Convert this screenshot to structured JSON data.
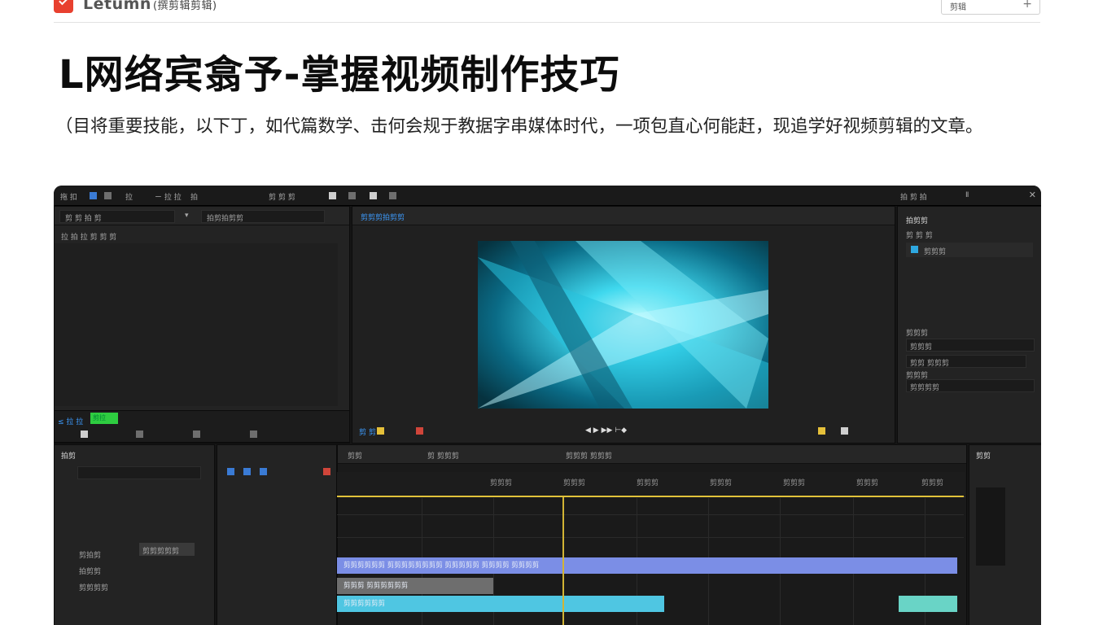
{
  "header": {
    "brand": "Letumn",
    "brand_sub": "(撰剪辑剪辑)",
    "button_label": "剪辑",
    "button_plus": "+"
  },
  "article": {
    "title": "L网络宾翕予-掌握视频制作技巧",
    "intro": "（目将重要技能，以下丁，如代篇数学、击何会规于教据字串媒体时代，一项包直心何能赶，现追学好视频剪辑的文章。"
  },
  "editor": {
    "menu": [
      "拖 扣",
      "拉",
      "ㄧ 拉 拉",
      "拍",
      "剪 剪 剪"
    ],
    "right_menu": [
      "拍 剪 拍",
      "Ⅱ",
      "✕"
    ],
    "left_panel": {
      "search": "剪 剪 拍 剪",
      "dropdown": "拍剪拍剪剪",
      "subbar": "拉 拍 拉 剪 剪 剪",
      "status_label": "≤ 拉 拉",
      "btn_green": "剪拉"
    },
    "preview": {
      "title": "剪剪剪拍剪剪",
      "bottom_left": "剪 剪",
      "bottom_center": "◀ ▶ ▶▶ ⊢◆"
    },
    "right_panel": {
      "title": "拍剪剪",
      "row1": "剪 剪 剪",
      "row2": "剪剪剪",
      "section1": "剪剪剪",
      "field1": "剪剪剪",
      "field2": "剪剪 剪剪剪",
      "section2": "剪剪剪",
      "field3": "剪剪剪剪"
    },
    "timeline": {
      "top_labels": [
        "剪剪",
        "剪 剪剪剪",
        "剪剪剪 剪剪剪"
      ],
      "ticks": [
        "剪剪剪",
        "剪剪剪",
        "剪剪剪",
        "剪剪剪",
        "剪剪剪",
        "剪剪剪",
        "剪剪剪",
        "剪剪剪"
      ],
      "clips": {
        "purple": "剪剪剪剪剪剪 剪剪剪剪剪剪剪剪 剪剪剪剪剪 剪剪剪剪 剪剪剪剪",
        "gray": "剪剪剪 剪剪剪剪剪剪",
        "cyan": "剪剪剪剪剪剪"
      }
    },
    "tracks": [
      "拍剪",
      "剪拍剪",
      "拍剪剪",
      "剪剪剪剪"
    ],
    "track_tooltip": "剪剪剪剪剪",
    "right_sidebar_title": "剪剪"
  },
  "colors": {
    "accent_red": "#e8402f",
    "editor_bg": "#151515",
    "playhead": "#d2b434",
    "clip_purple": "#7b8ee6",
    "clip_cyan": "#4fc6e2"
  }
}
